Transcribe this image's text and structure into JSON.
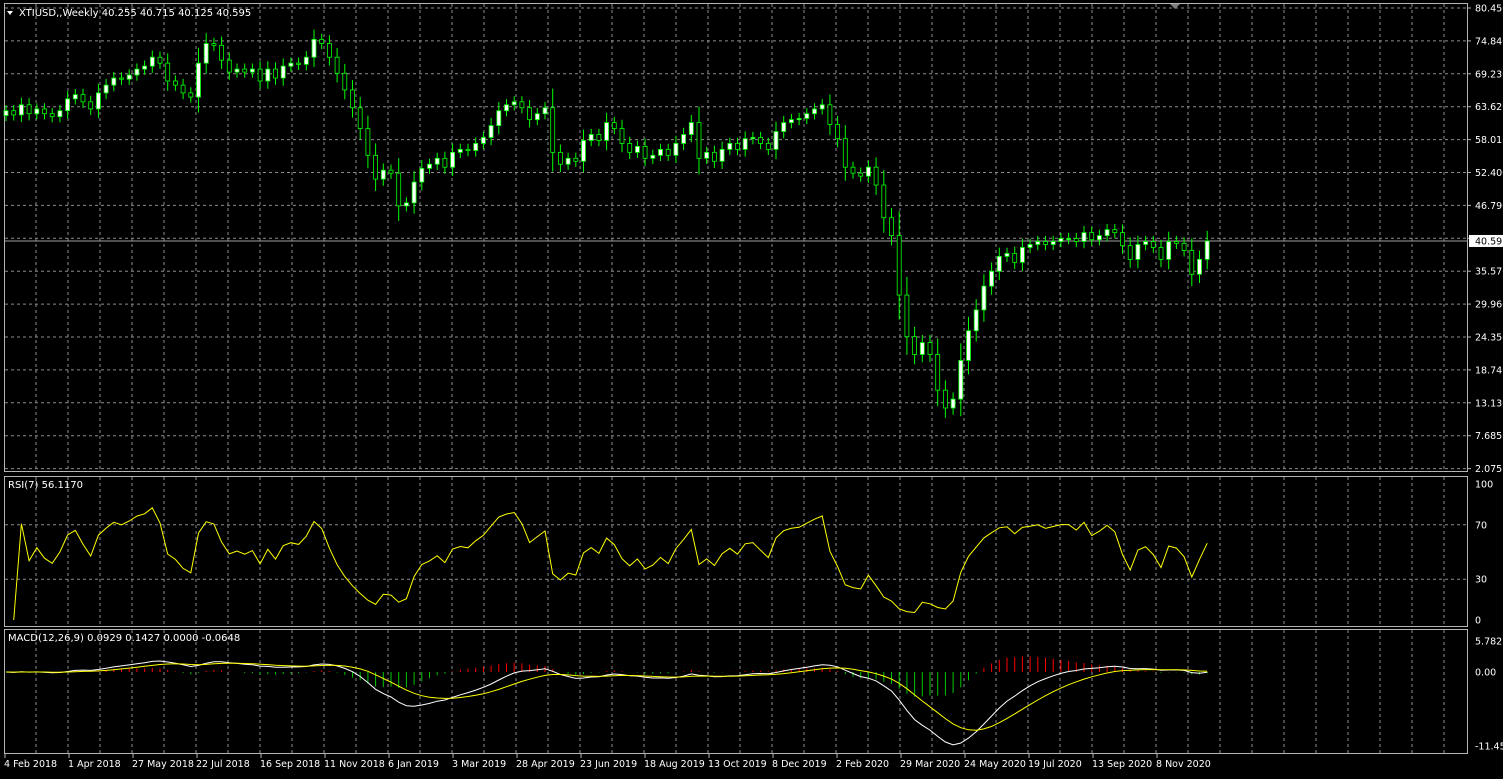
{
  "colors": {
    "background": "#000000",
    "grid": "#8c8c8c",
    "frame": "#b4b4b4",
    "text": "#ffffff",
    "bull_body": "#ffffff",
    "bear_body": "#000000",
    "candle_outline": "#00ff00",
    "rsi_line": "#ffff00",
    "macd_main": "#ffffff",
    "macd_signal": "#ffff00",
    "hist_up": "#ff0000",
    "hist_down": "#00c800",
    "price_line": "#a0a0a0"
  },
  "price_panel": {
    "header": "XTIUSD,,Weekly  40.255 40.715 40.125 40.595",
    "y_ticks": [
      "80.450",
      "74.840",
      "69.230",
      "63.620",
      "58.010",
      "52.400",
      "46.790",
      "41.180",
      "35.570",
      "29.960",
      "24.350",
      "18.740",
      "13.130",
      "7.685",
      "2.075"
    ],
    "current_price": "40.595",
    "current_value": 40.595
  },
  "rsi_panel": {
    "header": "RSI(7) 56.1170",
    "y_ticks": [
      "100",
      "70",
      "30",
      "0"
    ]
  },
  "macd_panel": {
    "header": "MACD(12,26,9) 0.0929 0.1427 0.0000 -0.0648",
    "y_ticks": [
      "5.7823",
      "0.00",
      "-11.4598"
    ]
  },
  "x_axis_labels": [
    "4 Feb 2018",
    "1 Apr 2018",
    "27 May 2018",
    "22 Jul 2018",
    "16 Sep 2018",
    "11 Nov 2018",
    "6 Jan 2019",
    "3 Mar 2019",
    "28 Apr 2019",
    "23 Jun 2019",
    "18 Aug 2019",
    "13 Oct 2019",
    "8 Dec 2019",
    "2 Feb 2020",
    "29 Mar 2020",
    "24 May 2020",
    "19 Jul 2020",
    "13 Sep 2020",
    "8 Nov 2020"
  ],
  "chart_data": {
    "type": "candlestick",
    "instrument": "XTIUSD",
    "timeframe": "Weekly",
    "price_range": [
      2.075,
      80.45
    ],
    "close": [
      62.5,
      61.8,
      63.5,
      62.0,
      62.8,
      62.0,
      61.5,
      62.5,
      64.5,
      65.2,
      64.0,
      62.8,
      65.5,
      66.8,
      68.0,
      67.8,
      68.5,
      69.5,
      70.0,
      71.5,
      70.5,
      67.5,
      66.8,
      65.5,
      64.8,
      70.5,
      73.8,
      73.5,
      71.0,
      69.0,
      69.5,
      69.0,
      69.5,
      67.5,
      69.5,
      68.0,
      70.0,
      70.5,
      70.3,
      71.5,
      74.5,
      73.8,
      71.5,
      68.8,
      66.0,
      63.0,
      59.5,
      55.0,
      51.0,
      52.5,
      52.0,
      46.5,
      47.0,
      50.5,
      52.8,
      53.5,
      54.5,
      53.0,
      55.5,
      56.0,
      55.8,
      57.0,
      58.0,
      60.0,
      62.5,
      63.5,
      64.0,
      63.0,
      61.0,
      62.0,
      63.0,
      55.5,
      53.5,
      54.5,
      54.0,
      57.5,
      58.5,
      57.5,
      60.5,
      59.5,
      57.0,
      55.5,
      56.5,
      54.5,
      55.0,
      56.0,
      55.0,
      57.0,
      58.5,
      60.5,
      54.5,
      55.5,
      54.0,
      56.0,
      57.0,
      56.0,
      57.8,
      58.0,
      57.0,
      56.0,
      59.0,
      60.5,
      61.0,
      61.2,
      62.0,
      62.8,
      63.5,
      60.2,
      57.8,
      53.0,
      52.0,
      51.5,
      53.0,
      50.0,
      44.5,
      41.5,
      31.5,
      24.5,
      21.5,
      23.5,
      21.5,
      15.5,
      12.5,
      14.0,
      20.5,
      25.5,
      29.0,
      33.0,
      35.5,
      38.0,
      38.5,
      37.0,
      39.5,
      40.0,
      40.5,
      40.0,
      40.5,
      41.0,
      41.0,
      40.5,
      42.0,
      40.8,
      41.5,
      42.5,
      42.0,
      39.8,
      37.5,
      40.0,
      40.5,
      39.5,
      37.5,
      40.5,
      40.2,
      39.0,
      35.0,
      37.5,
      40.6
    ]
  }
}
